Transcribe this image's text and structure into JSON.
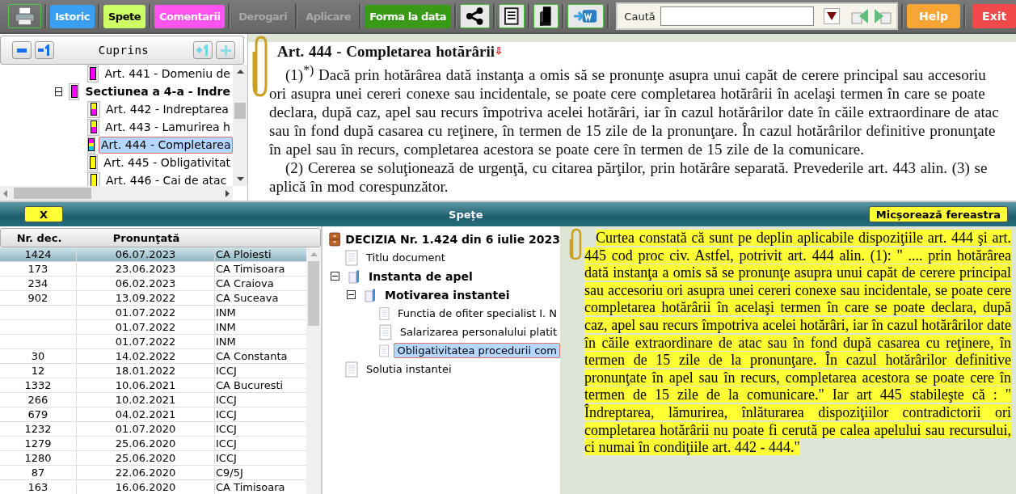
{
  "toolbar": {
    "text_buttons": [
      {
        "label": "Istoric",
        "color": "#3a9ff0",
        "disabled": false
      },
      {
        "label": "Spete",
        "color": "#ccff66",
        "disabled": false
      },
      {
        "label": "Comentarii",
        "color": "#ff55ee",
        "disabled": false
      },
      {
        "label": "Derogari",
        "color": "#6e6e6e",
        "disabled": true
      },
      {
        "label": "Aplicare",
        "color": "#6e6e6e",
        "disabled": true
      },
      {
        "label": "Forma la data",
        "color": "#3a9a18",
        "disabled": false
      }
    ],
    "search": {
      "label": "Caută"
    },
    "action_buttons": [
      {
        "label": "Help",
        "color": "#f7a535"
      },
      {
        "label": "Exit",
        "color": "#f24a4a"
      }
    ]
  },
  "toc": {
    "title": "Cuprins",
    "items": [
      {
        "label": "Art. 441 - Domeniu de",
        "kind": "article",
        "markers": [
          {
            "color": "#ff00ff"
          }
        ],
        "selected": false
      },
      {
        "label": "Sectiunea a 4-a - Indre",
        "kind": "section",
        "expanded": true,
        "markers": [
          {
            "color": "#ff00ff"
          }
        ],
        "selected": false,
        "children": [
          {
            "label": "Art. 442 - Indreptarea",
            "markers": [
              {
                "color": "#ffff00"
              },
              {
                "color": "#ff00ff"
              }
            ],
            "selected": false
          },
          {
            "label": "Art. 443 - Lamurirea h",
            "markers": [
              {
                "color": "#ffff00"
              },
              {
                "color": "#ff00ff"
              }
            ],
            "selected": false
          },
          {
            "label": "Art. 444 - Completarea",
            "markers": [
              {
                "color": "#ff00ff"
              },
              {
                "color": "#ffff00"
              },
              {
                "color": "#00c8e0"
              }
            ],
            "selected": true
          },
          {
            "label": "Art. 445 - Obligativitat",
            "markers": [
              {
                "color": "#ffff00"
              }
            ],
            "selected": false
          },
          {
            "label": "Art. 446 - Cai de atac",
            "markers": [
              {
                "color": "#ffff00"
              }
            ],
            "selected": false
          }
        ]
      }
    ]
  },
  "article": {
    "title": "Art. 444 - Completarea hotărârii",
    "title_mark": "⇩",
    "paragraphs": [
      "(1)$^{*)}$ Dacă prin hotărârea dată instanţa a omis să se pronunţe asupra unui capăt de cerere principal sau accesoriu ori asupra unei cereri conexe sau incidentale, se poate cere completarea hotărârii în acelaşi termen în care se poate declara, după caz, apel sau recurs împotriva acelei hotărâri, iar în cazul hotărârilor date în căile extraordinare de atac sau în fond după casarea cu reţinere, în termen de 15 zile de la pronunţare. În cazul hotărârilor definitive pronunţate în apel sau în recurs, completarea acestora se poate cere în termen de 15 zile de la comunicare.",
      "(2) Cererea se soluţionează de urgenţă, cu citarea părţilor, prin hotărâre separată. Prevederile art. 443 alin. (3) se aplică în mod corespunzător."
    ]
  },
  "spete": {
    "close": "X",
    "title": "Spețe",
    "shrink": "Micșorează fereastra",
    "table": {
      "columns": [
        "Nr. dec.",
        "Pronunţată"
      ],
      "rows": [
        {
          "nr_dec": "1424",
          "pronuntata": "06.07.2023",
          "column_3": "CA Ploiesti",
          "selected": true
        },
        {
          "nr_dec": "173",
          "pronuntata": "23.06.2023",
          "column_3": "CA Timisoara",
          "selected": false
        },
        {
          "nr_dec": "234",
          "pronuntata": "06.02.2023",
          "column_3": "CA Craiova",
          "selected": false
        },
        {
          "nr_dec": "902",
          "pronuntata": "13.09.2022",
          "column_3": "CA Suceava",
          "selected": false
        },
        {
          "pronuntata": "01.07.2022",
          "column_3": "INM",
          "selected": false
        },
        {
          "pronuntata": "01.07.2022",
          "column_3": "INM",
          "selected": false
        },
        {
          "pronuntata": "01.07.2022",
          "column_3": "INM",
          "selected": false
        },
        {
          "nr_dec": "30",
          "pronuntata": "14.02.2022",
          "column_3": "CA Constanta",
          "selected": false
        },
        {
          "nr_dec": "12",
          "pronuntata": "18.01.2022",
          "column_3": "ICCJ",
          "selected": false
        },
        {
          "nr_dec": "1332",
          "pronuntata": "10.06.2021",
          "column_3": "CA Bucuresti",
          "selected": false
        },
        {
          "nr_dec": "266",
          "pronuntata": "10.02.2021",
          "column_3": "ICCJ",
          "selected": false
        },
        {
          "nr_dec": "679",
          "pronuntata": "04.02.2021",
          "column_3": "ICCJ",
          "selected": false
        },
        {
          "nr_dec": "1232",
          "pronuntata": "01.07.2020",
          "column_3": "ICCJ",
          "selected": false
        },
        {
          "nr_dec": "1279",
          "pronuntata": "25.06.2020",
          "column_3": "ICCJ",
          "selected": false
        },
        {
          "nr_dec": "1280",
          "pronuntata": "25.06.2020",
          "column_3": "ICCJ",
          "selected": false
        },
        {
          "nr_dec": "87",
          "pronuntata": "22.06.2020",
          "column_3": "C9/5J",
          "selected": false
        },
        {
          "nr_dec": "163",
          "pronuntata": "16.06.2020",
          "column_3": "CA Timisoara",
          "selected": false
        }
      ]
    },
    "document": {
      "title": "DECIZIA Nr. 1.424 din 6 iulie 2023",
      "children": [
        {
          "label": "Titlu document",
          "kind": "page",
          "selected": false
        },
        {
          "label": "Instanta de apel",
          "kind": "folder",
          "expanded": true,
          "selected": false,
          "children": [
            {
              "label": "Motivarea instantei",
              "kind": "folder",
              "expanded": true,
              "selected": false,
              "children": [
                {
                  "label": "Functia de ofiter specialist I. N",
                  "selected": false
                },
                {
                  "label": "Salarizarea personalului platit",
                  "selected": false
                },
                {
                  "label": "Obligativitatea procedurii com",
                  "selected": true
                }
              ]
            }
          ]
        },
        {
          "label": "Solutia instantei",
          "kind": "page",
          "selected": false
        }
      ]
    },
    "excerpt": {
      "highlighted": true,
      "text": "Curtea constată că sunt pe deplin aplicabile dispoziţiile art. 444 şi art. 445 cod proc civ. Astfel, potrivit art. 444 alin. (1): \" .... prin hotărârea dată instanţa a omis să se pronunţe asupra unui capăt de cerere principal sau accesoriu ori asupra unei cereri conexe sau incidentale, se poate cere completarea hotărârii în acelaşi termen în care se poate declara, după caz, apel sau recurs împotriva acelei hotărâri, iar în cazul hotărârilor date în căile extraordinare de atac sau în fond după casarea cu reţinere, în termen de 15 zile de la pronunţare. În cazul hotărârilor definitive pronunţate în apel sau în recurs, completarea acestora se poate cere în termen de 15 zile de la comunicare.\" Iar art 445 stabileşte că : \" Îndreptarea, lămurirea, înlăturarea dispoziţiilor contradictorii ori completarea hotărârii nu poate fi cerută pe calea apelului sau recursului, ci numai în condiţiile art. 442 - 444.\""
    }
  }
}
